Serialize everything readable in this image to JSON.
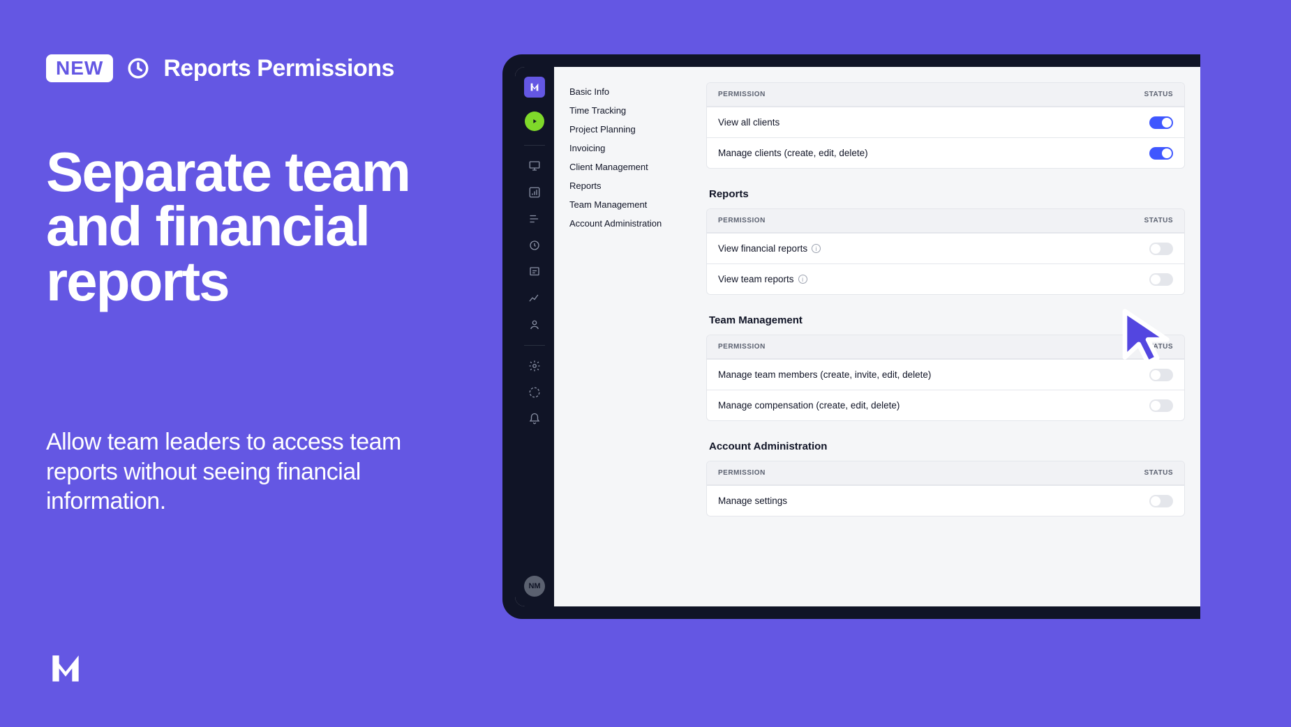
{
  "marketing": {
    "badge": "NEW",
    "section": "Reports Permissions",
    "headline": "Separate team and financial reports",
    "subtext": "Allow team leaders to access team reports without seeing financial information."
  },
  "rail": {
    "avatar": "NM"
  },
  "sectionNav": [
    "Basic Info",
    "Time Tracking",
    "Project Planning",
    "Invoicing",
    "Client Management",
    "Reports",
    "Team Management",
    "Account Administration"
  ],
  "tableLabels": {
    "permission": "PERMISSION",
    "status": "STATUS"
  },
  "groups": {
    "clients": {
      "rows": [
        {
          "label": "View all clients",
          "info": false,
          "on": true
        },
        {
          "label": "Manage clients (create, edit, delete)",
          "info": false,
          "on": true
        }
      ]
    },
    "reports": {
      "title": "Reports",
      "rows": [
        {
          "label": "View financial reports",
          "info": true,
          "on": false
        },
        {
          "label": "View team reports",
          "info": true,
          "on": false
        }
      ]
    },
    "team": {
      "title": "Team Management",
      "rows": [
        {
          "label": "Manage team members (create, invite, edit, delete)",
          "info": false,
          "on": false
        },
        {
          "label": "Manage compensation (create, edit, delete)",
          "info": false,
          "on": false
        }
      ]
    },
    "account": {
      "title": "Account Administration",
      "rows": [
        {
          "label": "Manage settings",
          "info": false,
          "on": false
        }
      ]
    }
  }
}
